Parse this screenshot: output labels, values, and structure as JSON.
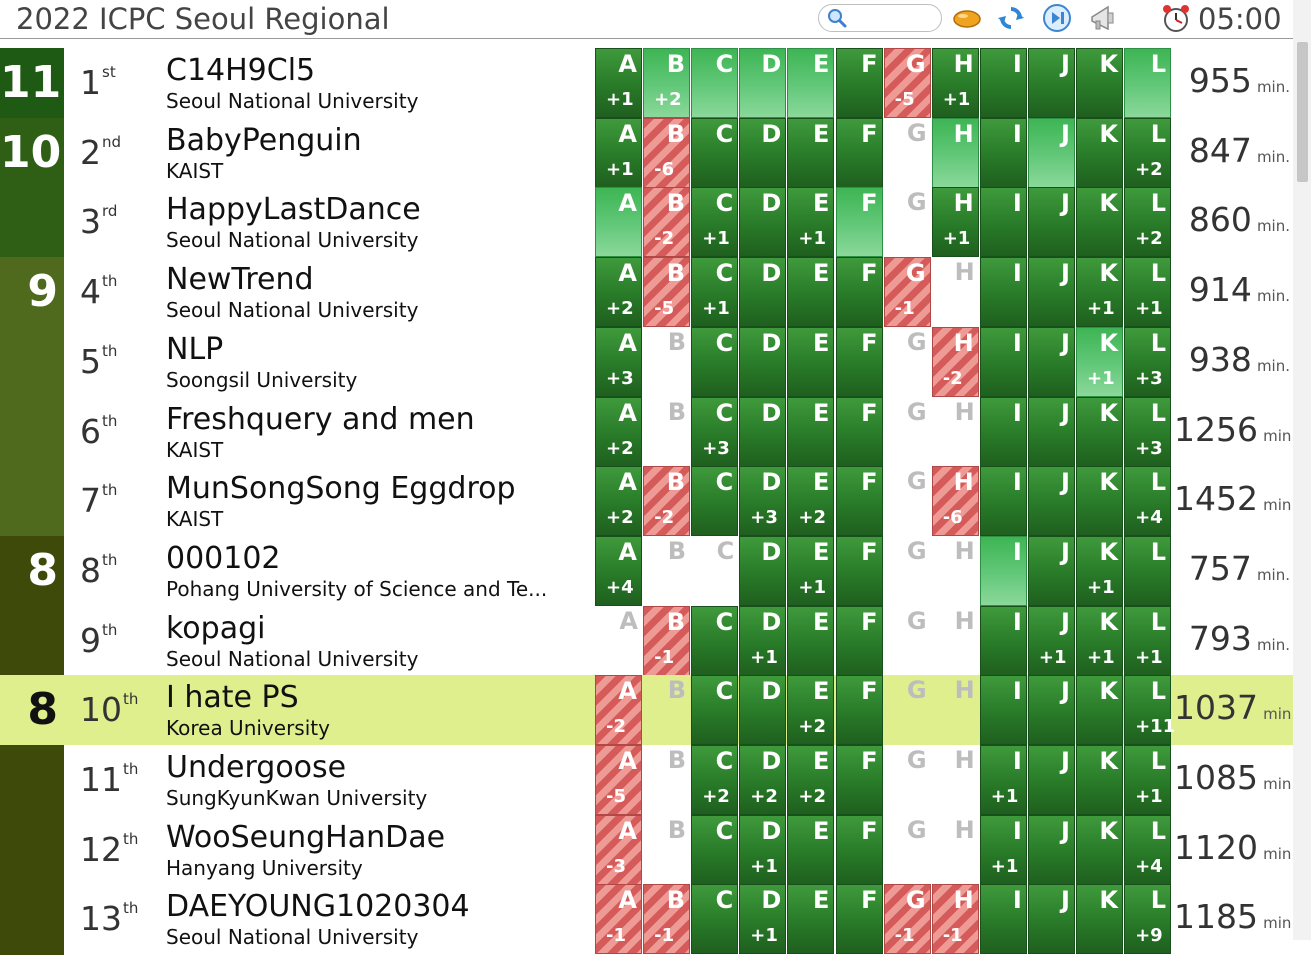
{
  "header": {
    "title": "2022 ICPC Seoul Regional",
    "search_placeholder": "",
    "timer": "05:00",
    "icons": [
      "search-icon",
      "balloon-icon",
      "refresh-icon",
      "play-next-icon",
      "megaphone-icon",
      "alarm-clock-icon"
    ]
  },
  "problems": [
    "A",
    "B",
    "C",
    "D",
    "E",
    "F",
    "G",
    "H",
    "I",
    "J",
    "K",
    "L"
  ],
  "minutes_unit": "min.",
  "colors": {
    "solved": "#2a7d2a",
    "first_solve": "#5ec674",
    "failed": "#d55a5a",
    "highlight": "#e0ef8e",
    "band_11": "#1f5a14",
    "band_10": "#2f5f14",
    "band_9": "#4f6a1c",
    "band_8": "#3e4a0a"
  },
  "rows": [
    {
      "solved": "11",
      "rank": "1",
      "suffix": "st",
      "team": "C14H9Cl5",
      "univ": "Seoul National University",
      "penalty": "955",
      "highlight": false,
      "cells": [
        [
          "s",
          "+1"
        ],
        [
          "f",
          "+2"
        ],
        [
          "f",
          ""
        ],
        [
          "f",
          ""
        ],
        [
          "f",
          ""
        ],
        [
          "s",
          ""
        ],
        [
          "x",
          "-5"
        ],
        [
          "s",
          "+1"
        ],
        [
          "s",
          ""
        ],
        [
          "s",
          ""
        ],
        [
          "s",
          ""
        ],
        [
          "f",
          ""
        ]
      ]
    },
    {
      "solved": "10",
      "rank": "2",
      "suffix": "nd",
      "team": "BabyPenguin",
      "univ": "KAIST",
      "penalty": "847",
      "highlight": false,
      "cells": [
        [
          "s",
          "+1"
        ],
        [
          "x",
          "-6"
        ],
        [
          "s",
          ""
        ],
        [
          "s",
          ""
        ],
        [
          "s",
          ""
        ],
        [
          "s",
          ""
        ],
        [
          "n",
          ""
        ],
        [
          "f",
          ""
        ],
        [
          "s",
          ""
        ],
        [
          "f",
          ""
        ],
        [
          "s",
          ""
        ],
        [
          "s",
          "+2"
        ]
      ]
    },
    {
      "solved": "",
      "rank": "3",
      "suffix": "rd",
      "team": "HappyLastDance",
      "univ": "Seoul National University",
      "penalty": "860",
      "highlight": false,
      "cells": [
        [
          "f",
          ""
        ],
        [
          "x",
          "-2"
        ],
        [
          "s",
          "+1"
        ],
        [
          "s",
          ""
        ],
        [
          "s",
          "+1"
        ],
        [
          "f",
          ""
        ],
        [
          "n",
          ""
        ],
        [
          "s",
          "+1"
        ],
        [
          "s",
          ""
        ],
        [
          "s",
          ""
        ],
        [
          "s",
          ""
        ],
        [
          "s",
          "+2"
        ]
      ]
    },
    {
      "solved": "9",
      "rank": "4",
      "suffix": "th",
      "team": "NewTrend",
      "univ": "Seoul National University",
      "penalty": "914",
      "highlight": false,
      "cells": [
        [
          "s",
          "+2"
        ],
        [
          "x",
          "-5"
        ],
        [
          "s",
          "+1"
        ],
        [
          "s",
          ""
        ],
        [
          "s",
          ""
        ],
        [
          "s",
          ""
        ],
        [
          "x",
          "-1"
        ],
        [
          "n",
          ""
        ],
        [
          "s",
          ""
        ],
        [
          "s",
          ""
        ],
        [
          "s",
          "+1"
        ],
        [
          "s",
          "+1"
        ]
      ]
    },
    {
      "solved": "",
      "rank": "5",
      "suffix": "th",
      "team": "NLP",
      "univ": "Soongsil University",
      "penalty": "938",
      "highlight": false,
      "cells": [
        [
          "s",
          "+3"
        ],
        [
          "n",
          ""
        ],
        [
          "s",
          ""
        ],
        [
          "s",
          ""
        ],
        [
          "s",
          ""
        ],
        [
          "s",
          ""
        ],
        [
          "n",
          ""
        ],
        [
          "x",
          "-2"
        ],
        [
          "s",
          ""
        ],
        [
          "s",
          ""
        ],
        [
          "f",
          "+1"
        ],
        [
          "s",
          "+3"
        ]
      ]
    },
    {
      "solved": "",
      "rank": "6",
      "suffix": "th",
      "team": "Freshquery and men",
      "univ": "KAIST",
      "penalty": "1256",
      "highlight": false,
      "cells": [
        [
          "s",
          "+2"
        ],
        [
          "n",
          ""
        ],
        [
          "s",
          "+3"
        ],
        [
          "s",
          ""
        ],
        [
          "s",
          ""
        ],
        [
          "s",
          ""
        ],
        [
          "n",
          ""
        ],
        [
          "n",
          ""
        ],
        [
          "s",
          ""
        ],
        [
          "s",
          ""
        ],
        [
          "s",
          ""
        ],
        [
          "s",
          "+3"
        ]
      ]
    },
    {
      "solved": "",
      "rank": "7",
      "suffix": "th",
      "team": "MunSongSong Eggdrop",
      "univ": "KAIST",
      "penalty": "1452",
      "highlight": false,
      "cells": [
        [
          "s",
          "+2"
        ],
        [
          "x",
          "-2"
        ],
        [
          "s",
          ""
        ],
        [
          "s",
          "+3"
        ],
        [
          "s",
          "+2"
        ],
        [
          "s",
          ""
        ],
        [
          "n",
          ""
        ],
        [
          "x",
          "-6"
        ],
        [
          "s",
          ""
        ],
        [
          "s",
          ""
        ],
        [
          "s",
          ""
        ],
        [
          "s",
          "+4"
        ]
      ]
    },
    {
      "solved": "8",
      "rank": "8",
      "suffix": "th",
      "team": "000102",
      "univ": "Pohang University of Science and Te...",
      "penalty": "757",
      "highlight": false,
      "cells": [
        [
          "s",
          "+4"
        ],
        [
          "n",
          ""
        ],
        [
          "n",
          ""
        ],
        [
          "s",
          ""
        ],
        [
          "s",
          "+1"
        ],
        [
          "s",
          ""
        ],
        [
          "n",
          ""
        ],
        [
          "n",
          ""
        ],
        [
          "f",
          ""
        ],
        [
          "s",
          ""
        ],
        [
          "s",
          "+1"
        ],
        [
          "s",
          ""
        ]
      ]
    },
    {
      "solved": "",
      "rank": "9",
      "suffix": "th",
      "team": "kopagi",
      "univ": "Seoul National University",
      "penalty": "793",
      "highlight": false,
      "cells": [
        [
          "n",
          ""
        ],
        [
          "x",
          "-1"
        ],
        [
          "s",
          ""
        ],
        [
          "s",
          "+1"
        ],
        [
          "s",
          ""
        ],
        [
          "s",
          ""
        ],
        [
          "n",
          ""
        ],
        [
          "n",
          ""
        ],
        [
          "s",
          ""
        ],
        [
          "s",
          "+1"
        ],
        [
          "s",
          "+1"
        ],
        [
          "s",
          "+1"
        ]
      ]
    },
    {
      "solved": "8",
      "rank": "10",
      "suffix": "th",
      "team": "I hate PS",
      "univ": "Korea University",
      "penalty": "1037",
      "highlight": true,
      "cells": [
        [
          "x",
          "-2"
        ],
        [
          "n",
          ""
        ],
        [
          "s",
          ""
        ],
        [
          "s",
          ""
        ],
        [
          "s",
          "+2"
        ],
        [
          "s",
          ""
        ],
        [
          "n",
          ""
        ],
        [
          "n",
          ""
        ],
        [
          "s",
          ""
        ],
        [
          "s",
          ""
        ],
        [
          "s",
          ""
        ],
        [
          "s",
          "+11"
        ]
      ]
    },
    {
      "solved": "",
      "rank": "11",
      "suffix": "th",
      "team": "Undergoose",
      "univ": "SungKyunKwan University",
      "penalty": "1085",
      "highlight": false,
      "cells": [
        [
          "x",
          "-5"
        ],
        [
          "n",
          ""
        ],
        [
          "s",
          "+2"
        ],
        [
          "s",
          "+2"
        ],
        [
          "s",
          "+2"
        ],
        [
          "s",
          ""
        ],
        [
          "n",
          ""
        ],
        [
          "n",
          ""
        ],
        [
          "s",
          "+1"
        ],
        [
          "s",
          ""
        ],
        [
          "s",
          ""
        ],
        [
          "s",
          "+1"
        ]
      ]
    },
    {
      "solved": "",
      "rank": "12",
      "suffix": "th",
      "team": "WooSeungHanDae",
      "univ": "Hanyang University",
      "penalty": "1120",
      "highlight": false,
      "cells": [
        [
          "x",
          "-3"
        ],
        [
          "n",
          ""
        ],
        [
          "s",
          ""
        ],
        [
          "s",
          "+1"
        ],
        [
          "s",
          ""
        ],
        [
          "s",
          ""
        ],
        [
          "n",
          ""
        ],
        [
          "n",
          ""
        ],
        [
          "s",
          "+1"
        ],
        [
          "s",
          ""
        ],
        [
          "s",
          ""
        ],
        [
          "s",
          "+4"
        ]
      ]
    },
    {
      "solved": "",
      "rank": "13",
      "suffix": "th",
      "team": "DAEYOUNG1020304",
      "univ": "Seoul National University",
      "penalty": "1185",
      "highlight": false,
      "cells": [
        [
          "x",
          "-1"
        ],
        [
          "x",
          "-1"
        ],
        [
          "s",
          ""
        ],
        [
          "s",
          "+1"
        ],
        [
          "s",
          ""
        ],
        [
          "s",
          ""
        ],
        [
          "x",
          "-1"
        ],
        [
          "x",
          "-1"
        ],
        [
          "s",
          ""
        ],
        [
          "s",
          ""
        ],
        [
          "s",
          ""
        ],
        [
          "s",
          "+9"
        ]
      ]
    }
  ]
}
